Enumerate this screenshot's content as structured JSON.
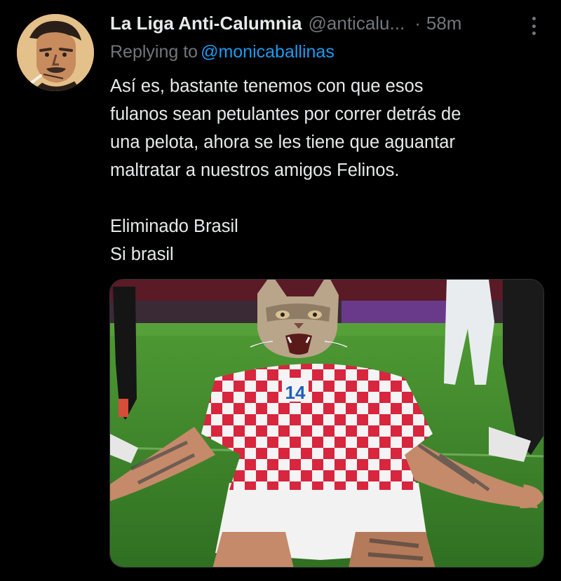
{
  "tweet": {
    "author_name": "La Liga Anti-Calumnia",
    "author_handle": "@anticalu...",
    "separator": "·",
    "time": "58m",
    "more_icon": "more-vertical-icon",
    "replying_to_label": "Replying to",
    "replying_to_handle": "@monicaballinas",
    "body_lines": [
      "Así es, bastante tenemos con que esos",
      "fulanos sean petulantes por correr detrás de",
      "una pelota, ahora se les tiene que aguantar",
      "maltratar a nuestros amigos Felinos."
    ],
    "body_lines_2": [
      "Eliminado Brasil",
      "Si brasil"
    ],
    "media": {
      "jersey_number": "14"
    }
  },
  "colors": {
    "background": "#000000",
    "text": "#e7e9ea",
    "muted": "#71767b",
    "link": "#1d9bf0",
    "pitch": "#3f8a2c",
    "jersey_red": "#d7263d"
  }
}
